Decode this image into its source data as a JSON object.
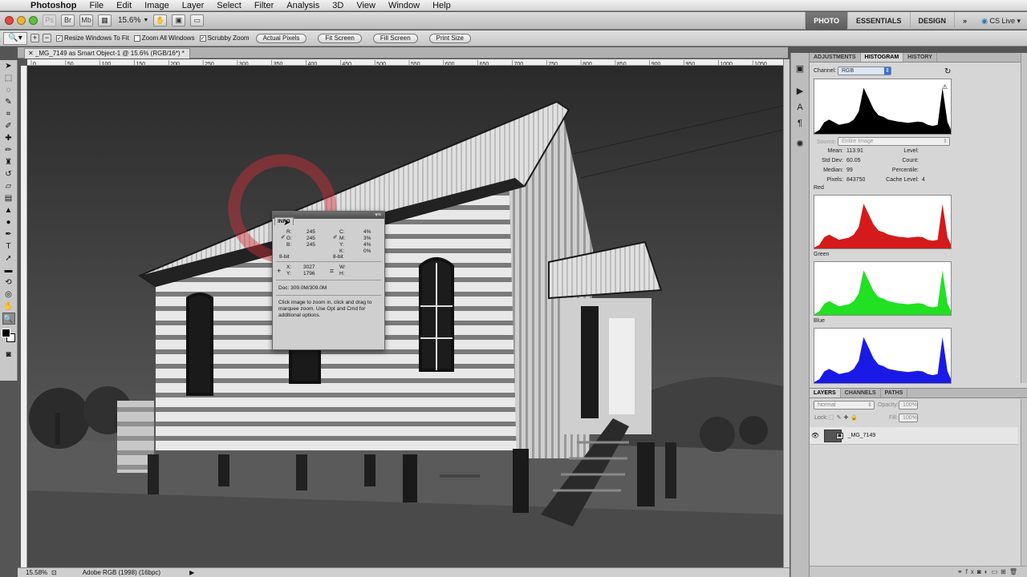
{
  "menubar": {
    "items": [
      "Photoshop",
      "File",
      "Edit",
      "Image",
      "Layer",
      "Select",
      "Filter",
      "Analysis",
      "3D",
      "View",
      "Window",
      "Help"
    ]
  },
  "appbar": {
    "icons": [
      "Ps",
      "Br",
      "Mb"
    ],
    "zoom": "15.6%",
    "workspaces": [
      "PHOTO",
      "ESSENTIALS",
      "DESIGN"
    ],
    "active_workspace": "PHOTO",
    "overflow": "»",
    "cs_live": "CS Live"
  },
  "options": {
    "resize_windows": "Resize Windows To Fit",
    "zoom_all": "Zoom All Windows",
    "scrubby_zoom": "Scrubby Zoom",
    "buttons": [
      "Actual Pixels",
      "Fit Screen",
      "Fill Screen",
      "Print Size"
    ]
  },
  "document": {
    "tab_title": "_MG_7149 as Smart Object-1 @ 15.6% (RGB/16*) *"
  },
  "ruler": {
    "labels": [
      "0",
      "50",
      "100",
      "150",
      "200",
      "250",
      "300",
      "350",
      "400",
      "450",
      "500",
      "550",
      "600",
      "650",
      "700",
      "750",
      "800",
      "850",
      "900",
      "950",
      "1000",
      "1050"
    ]
  },
  "info_panel": {
    "tab": "INFO",
    "r": "245",
    "g": "245",
    "b": "245",
    "c": "4%",
    "m": "3%",
    "y": "4%",
    "k": "0%",
    "bit_left": "8-bit",
    "bit_right": "8-bit",
    "x": "3027",
    "y_coord": "1796",
    "w": "",
    "h": "",
    "doc": "Doc: 309.0M/309.0M",
    "help": "Click image to zoom in, click and drag to marquee zoom.  Use Opt and Cmd for additional options."
  },
  "histogram_panel": {
    "tabs": [
      "ADJUSTMENTS",
      "HISTOGRAM",
      "HISTORY"
    ],
    "active_tab": "HISTOGRAM",
    "channel_label": "Channel:",
    "channel_value": "RGB",
    "source_label": "Source:",
    "source_value": "Entire Image",
    "stats_left": [
      [
        "Mean:",
        "113.91"
      ],
      [
        "Std Dev:",
        "60.05"
      ],
      [
        "Median:",
        "99"
      ],
      [
        "Pixels:",
        "843750"
      ]
    ],
    "stats_right": [
      [
        "Level:",
        ""
      ],
      [
        "Count:",
        ""
      ],
      [
        "Percentile:",
        ""
      ],
      [
        "Cache Level:",
        "4"
      ]
    ],
    "channels": [
      "Red",
      "Green",
      "Blue"
    ]
  },
  "layers_panel": {
    "tabs": [
      "LAYERS",
      "CHANNELS",
      "PATHS"
    ],
    "active_tab": "LAYERS",
    "blend_mode": "Normal",
    "opacity_label": "Opacity:",
    "opacity": "100%",
    "lock_label": "Lock:",
    "fill_label": "Fill:",
    "fill": "100%",
    "layer_name": "_MG_7149"
  },
  "statusbar": {
    "zoom": "15.58%",
    "profile": "Adobe RGB (1998) (16bpc)"
  },
  "colors": {
    "red_hist": "#d41a1a",
    "green_hist": "#22e022",
    "blue_hist": "#1a1ae6",
    "cursor_ring": "#d0303a"
  }
}
